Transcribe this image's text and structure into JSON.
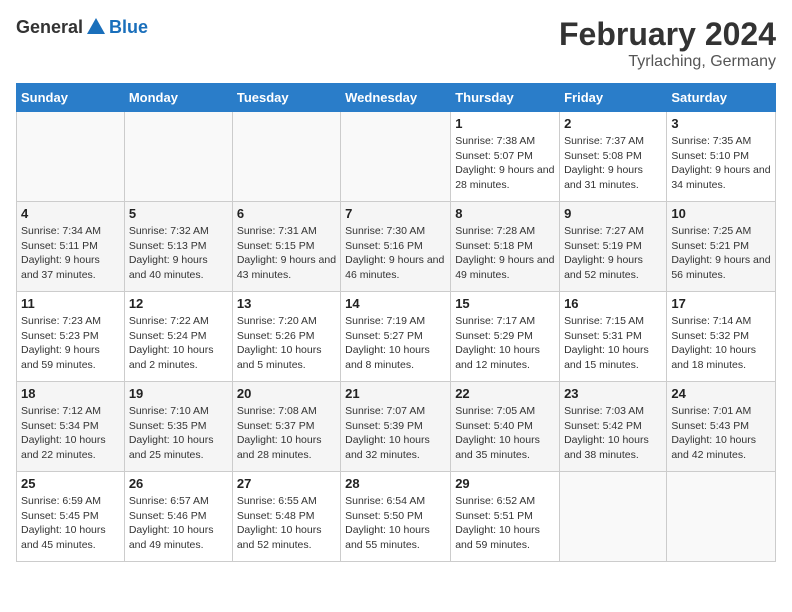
{
  "header": {
    "logo_general": "General",
    "logo_blue": "Blue",
    "month": "February 2024",
    "location": "Tyrlaching, Germany"
  },
  "days_of_week": [
    "Sunday",
    "Monday",
    "Tuesday",
    "Wednesday",
    "Thursday",
    "Friday",
    "Saturday"
  ],
  "weeks": [
    [
      {
        "day": "",
        "sunrise": "",
        "sunset": "",
        "daylight": ""
      },
      {
        "day": "",
        "sunrise": "",
        "sunset": "",
        "daylight": ""
      },
      {
        "day": "",
        "sunrise": "",
        "sunset": "",
        "daylight": ""
      },
      {
        "day": "",
        "sunrise": "",
        "sunset": "",
        "daylight": ""
      },
      {
        "day": "1",
        "sunrise": "Sunrise: 7:38 AM",
        "sunset": "Sunset: 5:07 PM",
        "daylight": "Daylight: 9 hours and 28 minutes."
      },
      {
        "day": "2",
        "sunrise": "Sunrise: 7:37 AM",
        "sunset": "Sunset: 5:08 PM",
        "daylight": "Daylight: 9 hours and 31 minutes."
      },
      {
        "day": "3",
        "sunrise": "Sunrise: 7:35 AM",
        "sunset": "Sunset: 5:10 PM",
        "daylight": "Daylight: 9 hours and 34 minutes."
      }
    ],
    [
      {
        "day": "4",
        "sunrise": "Sunrise: 7:34 AM",
        "sunset": "Sunset: 5:11 PM",
        "daylight": "Daylight: 9 hours and 37 minutes."
      },
      {
        "day": "5",
        "sunrise": "Sunrise: 7:32 AM",
        "sunset": "Sunset: 5:13 PM",
        "daylight": "Daylight: 9 hours and 40 minutes."
      },
      {
        "day": "6",
        "sunrise": "Sunrise: 7:31 AM",
        "sunset": "Sunset: 5:15 PM",
        "daylight": "Daylight: 9 hours and 43 minutes."
      },
      {
        "day": "7",
        "sunrise": "Sunrise: 7:30 AM",
        "sunset": "Sunset: 5:16 PM",
        "daylight": "Daylight: 9 hours and 46 minutes."
      },
      {
        "day": "8",
        "sunrise": "Sunrise: 7:28 AM",
        "sunset": "Sunset: 5:18 PM",
        "daylight": "Daylight: 9 hours and 49 minutes."
      },
      {
        "day": "9",
        "sunrise": "Sunrise: 7:27 AM",
        "sunset": "Sunset: 5:19 PM",
        "daylight": "Daylight: 9 hours and 52 minutes."
      },
      {
        "day": "10",
        "sunrise": "Sunrise: 7:25 AM",
        "sunset": "Sunset: 5:21 PM",
        "daylight": "Daylight: 9 hours and 56 minutes."
      }
    ],
    [
      {
        "day": "11",
        "sunrise": "Sunrise: 7:23 AM",
        "sunset": "Sunset: 5:23 PM",
        "daylight": "Daylight: 9 hours and 59 minutes."
      },
      {
        "day": "12",
        "sunrise": "Sunrise: 7:22 AM",
        "sunset": "Sunset: 5:24 PM",
        "daylight": "Daylight: 10 hours and 2 minutes."
      },
      {
        "day": "13",
        "sunrise": "Sunrise: 7:20 AM",
        "sunset": "Sunset: 5:26 PM",
        "daylight": "Daylight: 10 hours and 5 minutes."
      },
      {
        "day": "14",
        "sunrise": "Sunrise: 7:19 AM",
        "sunset": "Sunset: 5:27 PM",
        "daylight": "Daylight: 10 hours and 8 minutes."
      },
      {
        "day": "15",
        "sunrise": "Sunrise: 7:17 AM",
        "sunset": "Sunset: 5:29 PM",
        "daylight": "Daylight: 10 hours and 12 minutes."
      },
      {
        "day": "16",
        "sunrise": "Sunrise: 7:15 AM",
        "sunset": "Sunset: 5:31 PM",
        "daylight": "Daylight: 10 hours and 15 minutes."
      },
      {
        "day": "17",
        "sunrise": "Sunrise: 7:14 AM",
        "sunset": "Sunset: 5:32 PM",
        "daylight": "Daylight: 10 hours and 18 minutes."
      }
    ],
    [
      {
        "day": "18",
        "sunrise": "Sunrise: 7:12 AM",
        "sunset": "Sunset: 5:34 PM",
        "daylight": "Daylight: 10 hours and 22 minutes."
      },
      {
        "day": "19",
        "sunrise": "Sunrise: 7:10 AM",
        "sunset": "Sunset: 5:35 PM",
        "daylight": "Daylight: 10 hours and 25 minutes."
      },
      {
        "day": "20",
        "sunrise": "Sunrise: 7:08 AM",
        "sunset": "Sunset: 5:37 PM",
        "daylight": "Daylight: 10 hours and 28 minutes."
      },
      {
        "day": "21",
        "sunrise": "Sunrise: 7:07 AM",
        "sunset": "Sunset: 5:39 PM",
        "daylight": "Daylight: 10 hours and 32 minutes."
      },
      {
        "day": "22",
        "sunrise": "Sunrise: 7:05 AM",
        "sunset": "Sunset: 5:40 PM",
        "daylight": "Daylight: 10 hours and 35 minutes."
      },
      {
        "day": "23",
        "sunrise": "Sunrise: 7:03 AM",
        "sunset": "Sunset: 5:42 PM",
        "daylight": "Daylight: 10 hours and 38 minutes."
      },
      {
        "day": "24",
        "sunrise": "Sunrise: 7:01 AM",
        "sunset": "Sunset: 5:43 PM",
        "daylight": "Daylight: 10 hours and 42 minutes."
      }
    ],
    [
      {
        "day": "25",
        "sunrise": "Sunrise: 6:59 AM",
        "sunset": "Sunset: 5:45 PM",
        "daylight": "Daylight: 10 hours and 45 minutes."
      },
      {
        "day": "26",
        "sunrise": "Sunrise: 6:57 AM",
        "sunset": "Sunset: 5:46 PM",
        "daylight": "Daylight: 10 hours and 49 minutes."
      },
      {
        "day": "27",
        "sunrise": "Sunrise: 6:55 AM",
        "sunset": "Sunset: 5:48 PM",
        "daylight": "Daylight: 10 hours and 52 minutes."
      },
      {
        "day": "28",
        "sunrise": "Sunrise: 6:54 AM",
        "sunset": "Sunset: 5:50 PM",
        "daylight": "Daylight: 10 hours and 55 minutes."
      },
      {
        "day": "29",
        "sunrise": "Sunrise: 6:52 AM",
        "sunset": "Sunset: 5:51 PM",
        "daylight": "Daylight: 10 hours and 59 minutes."
      },
      {
        "day": "",
        "sunrise": "",
        "sunset": "",
        "daylight": ""
      },
      {
        "day": "",
        "sunrise": "",
        "sunset": "",
        "daylight": ""
      }
    ]
  ]
}
